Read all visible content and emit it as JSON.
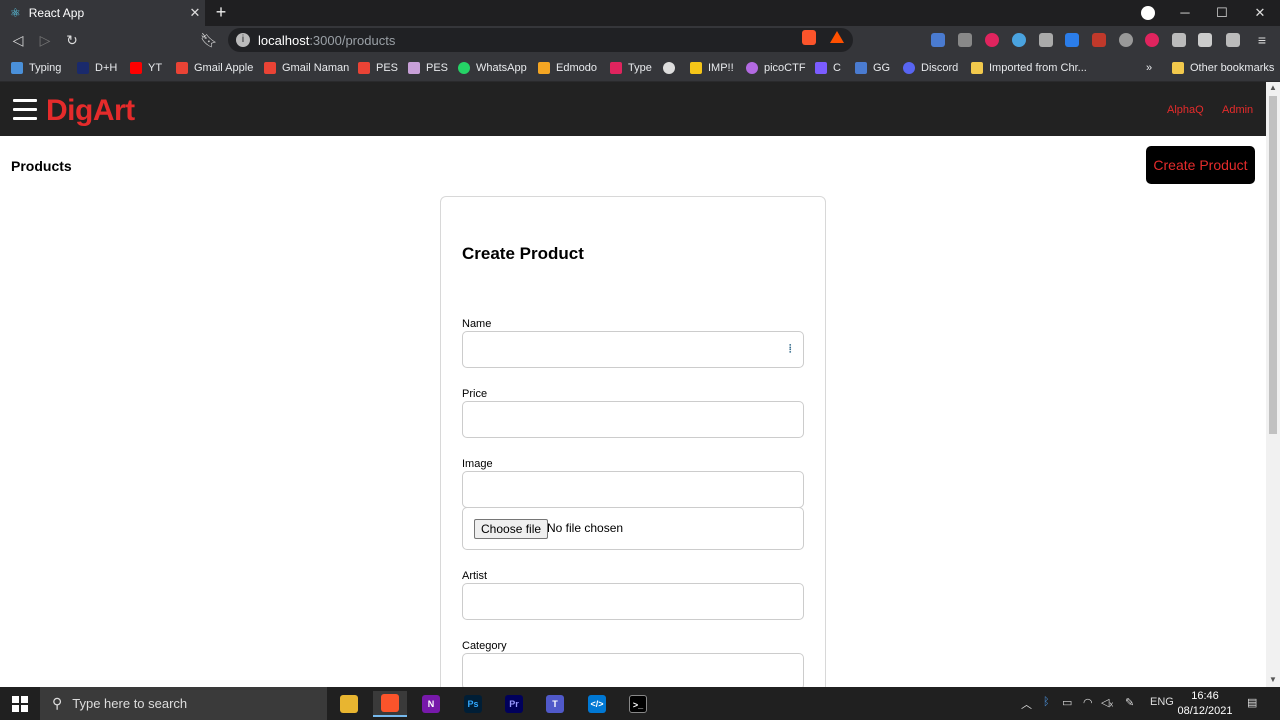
{
  "browser": {
    "tab_title": "React App",
    "url_host": "localhost",
    "url_path": ":3000/products",
    "bookmarks": [
      {
        "label": "Typing",
        "color": "#4a90d9"
      },
      {
        "label": "D+H",
        "color": "#1a2a6c"
      },
      {
        "label": "YT",
        "color": "#ff0000"
      },
      {
        "label": "Gmail Apple",
        "color": "#ea4335"
      },
      {
        "label": "Gmail Naman",
        "color": "#ea4335"
      },
      {
        "label": "PES",
        "color": "#ea4335"
      },
      {
        "label": "PES",
        "color": "#c8a0d8"
      },
      {
        "label": "WhatsApp",
        "color": "#25d366"
      },
      {
        "label": "Edmodo",
        "color": "#f5a623"
      },
      {
        "label": "Type",
        "color": "#e0245e"
      },
      {
        "label": "",
        "color": "#dddddd"
      },
      {
        "label": "IMP!!",
        "color": "#f5c518"
      },
      {
        "label": "picoCTF",
        "color": "#b36ae2"
      },
      {
        "label": "C",
        "color": "#7b5cff"
      },
      {
        "label": "GG",
        "color": "#4a7bd0"
      },
      {
        "label": "Discord",
        "color": "#5865f2"
      },
      {
        "label": "Imported from Chr...",
        "color": "#f2c94c"
      }
    ],
    "more_bookmarks": "»",
    "other_bookmarks": "Other bookmarks"
  },
  "header": {
    "logo": "DigArt",
    "links": [
      "AlphaQ",
      "Admin"
    ]
  },
  "page": {
    "title": "Products",
    "create_button": "Create Product"
  },
  "form": {
    "title": "Create Product",
    "fields": {
      "name_label": "Name",
      "price_label": "Price",
      "image_label": "Image",
      "artist_label": "Artist",
      "category_label": "Category"
    },
    "file": {
      "button": "Choose file",
      "status": "No file chosen"
    }
  },
  "taskbar": {
    "search_placeholder": "Type here to search",
    "language": "ENG",
    "time": "16:46",
    "date": "08/12/2021"
  },
  "colors": {
    "accent": "#e52b2b",
    "header_bg": "#222222"
  }
}
